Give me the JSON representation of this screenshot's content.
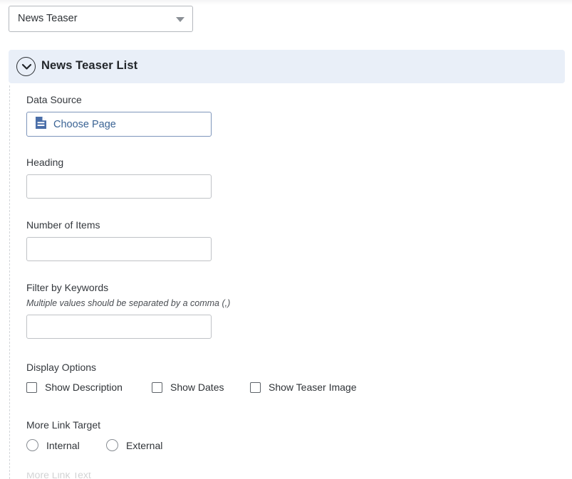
{
  "colors": {
    "panel_header_bg": "#e9eff8",
    "link_blue": "#3a6394",
    "button_border_blue": "#7e95bb",
    "text": "#2f3337",
    "border_gray": "#bfc2c6"
  },
  "type_select": {
    "value": "News Teaser",
    "caret_icon": "caret-down-icon"
  },
  "panel": {
    "title": "News Teaser List",
    "toggle_icon": "chevron-down-circle-icon",
    "expanded": true
  },
  "fields": {
    "data_source": {
      "label": "Data Source",
      "button_label": "Choose Page",
      "button_icon": "document-page-icon"
    },
    "heading": {
      "label": "Heading",
      "value": "",
      "placeholder": ""
    },
    "number_of_items": {
      "label": "Number of Items",
      "value": "",
      "placeholder": ""
    },
    "filter_by_keywords": {
      "label": "Filter by Keywords",
      "hint": "Multiple values should be separated by a comma (,)",
      "value": "",
      "placeholder": ""
    },
    "display_options": {
      "label": "Display Options",
      "options": [
        {
          "label": "Show Description",
          "checked": false
        },
        {
          "label": "Show Dates",
          "checked": false
        },
        {
          "label": "Show Teaser Image",
          "checked": false
        }
      ]
    },
    "more_link_target": {
      "label": "More Link Target",
      "options": [
        {
          "label": "Internal",
          "selected": false
        },
        {
          "label": "External",
          "selected": false
        }
      ]
    },
    "more_link_text": {
      "label": "More Link Text"
    }
  }
}
